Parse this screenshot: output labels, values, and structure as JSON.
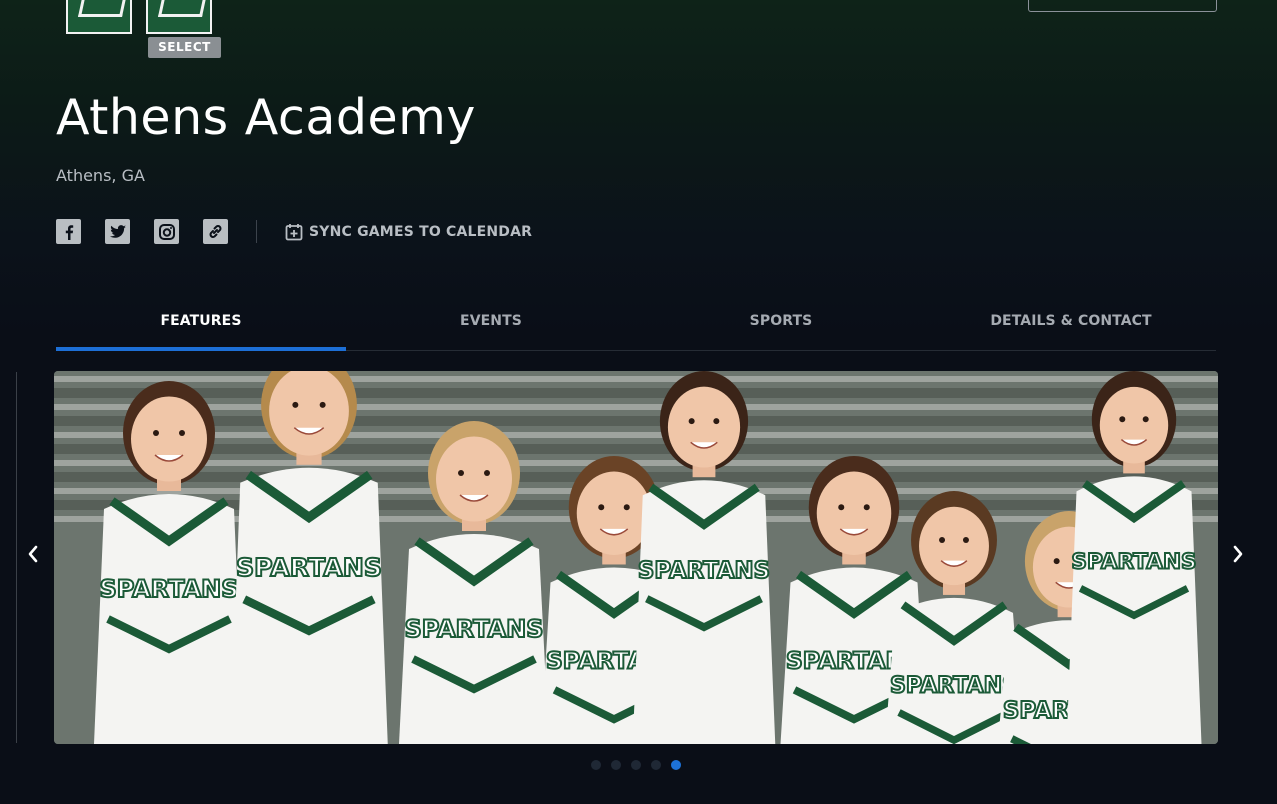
{
  "header": {
    "logo_badge": "SELECT"
  },
  "school": {
    "name": "Athens Academy",
    "location": "Athens, GA"
  },
  "social": {
    "icons": [
      "facebook-icon",
      "twitter-icon",
      "instagram-icon",
      "link-icon"
    ],
    "sync_label": "SYNC GAMES TO CALENDAR"
  },
  "tabs": [
    {
      "label": "FEATURES",
      "active": true
    },
    {
      "label": "EVENTS",
      "active": false
    },
    {
      "label": "SPORTS",
      "active": false
    },
    {
      "label": "DETAILS & CONTACT",
      "active": false
    }
  ],
  "carousel": {
    "slide_count": 5,
    "active_index": 4,
    "jersey_text": "SPARTANS"
  },
  "colors": {
    "accent": "#1d6fd6",
    "team_green": "#1b5a37",
    "background": "#0a0e17"
  }
}
